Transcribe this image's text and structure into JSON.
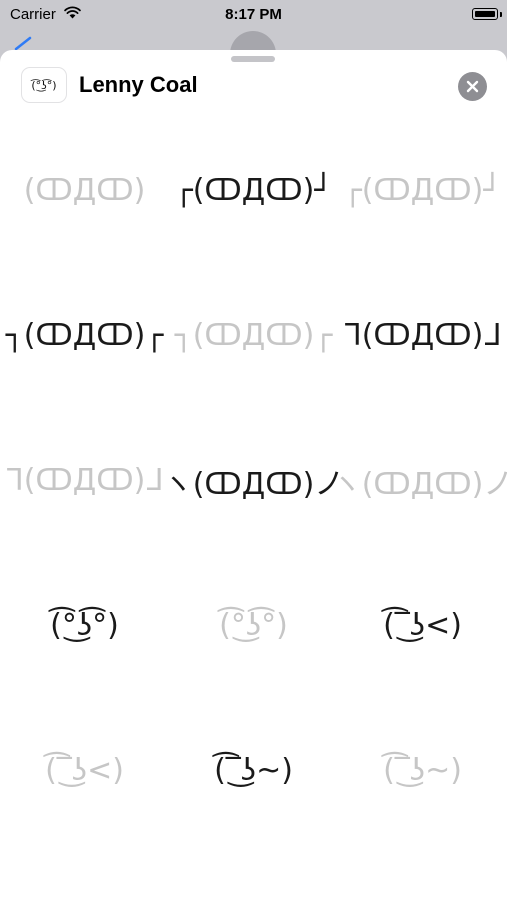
{
  "status_bar": {
    "carrier": "Carrier",
    "time": "8:17 PM"
  },
  "sheet": {
    "app_icon_text": "(͡°͜ʖ͡°)",
    "title": "Lenny Coal",
    "close_icon": "close-icon"
  },
  "stickers": [
    {
      "text": "(ↀДↀ)",
      "dim": true
    },
    {
      "text": "┌(ↀДↀ)┘",
      "dim": false
    },
    {
      "text": "┌(ↀДↀ)┘",
      "dim": true
    },
    {
      "text": "┐(ↀДↀ)┌",
      "dim": false
    },
    {
      "text": "┐(ↀДↀ)┌",
      "dim": true
    },
    {
      "text": "ᒣ(ↀДↀ)ᒧ",
      "dim": false
    },
    {
      "text": "ᒣ(ↀДↀ)ᒧ",
      "dim": true
    },
    {
      "text": "ヽ(ↀДↀ)ノ",
      "dim": false
    },
    {
      "text": "ヽ(ↀДↀ)ノ",
      "dim": true
    },
    {
      "text": "(͡°͜ʖ͡°)",
      "dim": false
    },
    {
      "text": "(͡°͜ʖ͡°)",
      "dim": true
    },
    {
      "text": "(͡‾͜ʖ<)",
      "dim": false
    },
    {
      "text": "(͡‾͜ʖ<)",
      "dim": true
    },
    {
      "text": "(͡‾͜ʖ~)",
      "dim": false
    },
    {
      "text": "(͡‾͜ʖ~)",
      "dim": true
    }
  ]
}
